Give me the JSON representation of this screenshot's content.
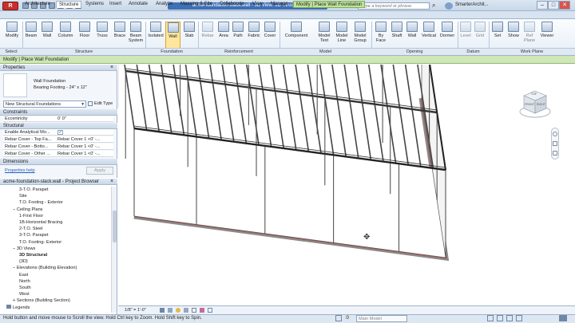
{
  "app": {
    "logo_letter": "R",
    "doc_title": "acme-foundation-slack.wall - 3D View: 3D Structural",
    "search_placeholder": "Type a keyword or phrase",
    "user": "SmarterArchit...",
    "min": "–",
    "max": "□",
    "close": "✕"
  },
  "tabs": [
    "Architecture",
    "Structure",
    "Systems",
    "Insert",
    "Annotate",
    "Analyze",
    "Massing & Site",
    "Collaborate",
    "View",
    "Manage",
    "Modify | Place Wall Foundation"
  ],
  "ribbon": {
    "buttons": [
      "Modify",
      "Beam",
      "Wall",
      "Column",
      "Floor",
      "Truss",
      "Brace",
      "Beam System",
      "Isolated",
      "Wall",
      "Slab",
      "Rebar",
      "Area",
      "Path",
      "Fabric",
      "Cover",
      "Component",
      "Model Text",
      "Model Line",
      "Model Group",
      "By Face",
      "Shaft",
      "Wall",
      "Vertical",
      "Dormer",
      "Level",
      "Grid",
      "Set",
      "Show",
      "Ref Plane",
      "Viewer"
    ],
    "panels": [
      "Select",
      "Structure",
      "Foundation",
      "Reinforcement",
      "Model",
      "Opening",
      "Datum",
      "Work Plane"
    ]
  },
  "options_bar": "Modify | Place Wall Foundation",
  "properties": {
    "title": "Properties",
    "type_name": "Wall Foundation",
    "type_sub": "Bearing Footing - 24\" x 12\"",
    "selector": "New Structural Foundations",
    "edit_type": "Edit Type",
    "sections": {
      "constraints": "Constraints",
      "structural": "Structural",
      "dimensions": "Dimensions"
    },
    "rows": [
      {
        "label": "Eccentricity",
        "value": "0' 0\""
      },
      {
        "label": "Enable Analytical Mo...",
        "value": "✓"
      },
      {
        "label": "Rebar Cover - Top Fa...",
        "value": "Rebar Cover 1 <0' -..."
      },
      {
        "label": "Rebar Cover - Botto...",
        "value": "Rebar Cover 1 <0' -..."
      },
      {
        "label": "Rebar Cover - Other ...",
        "value": "Rebar Cover 1 <0' -..."
      }
    ],
    "help": "Properties help",
    "apply": "Apply"
  },
  "browser": {
    "title": "acme-foundation-slack.wall - Project Browser",
    "items": [
      {
        "t": "3-T.O. Parapet",
        "l": 3
      },
      {
        "t": "Site",
        "l": 3
      },
      {
        "t": "T.O. Footing - Exterior",
        "l": 3
      },
      {
        "t": "Ceiling Plans",
        "l": 2,
        "exp": "−"
      },
      {
        "t": "1-First Floor",
        "l": 3
      },
      {
        "t": "1B-Horizontal Bracing",
        "l": 3
      },
      {
        "t": "2-T.O. Steel",
        "l": 3
      },
      {
        "t": "3-T.O. Parapet",
        "l": 3
      },
      {
        "t": "T.O. Footing- Exterior",
        "l": 3
      },
      {
        "t": "3D Views",
        "l": 2,
        "exp": "−"
      },
      {
        "t": "3D Structural",
        "l": 3,
        "b": true
      },
      {
        "t": "{3D}",
        "l": 3
      },
      {
        "t": "Elevations (Building Elevation)",
        "l": 2,
        "exp": "−"
      },
      {
        "t": "East",
        "l": 3
      },
      {
        "t": "North",
        "l": 3
      },
      {
        "t": "South",
        "l": 3
      },
      {
        "t": "West",
        "l": 3
      },
      {
        "t": "Sections (Building Section)",
        "l": 2,
        "exp": "+"
      },
      {
        "t": "Legends",
        "l": 1,
        "ico": true
      }
    ]
  },
  "viewcube": {
    "top": "TOP",
    "front": "FRONT",
    "right": "RIGHT"
  },
  "view_scale": "1/8\" = 1'-0\"",
  "status": {
    "hint": "Hold button and move mouse to Scroll the view. Hold Ctrl key to Zoom. Hold Shift key to Spin.",
    "zero": ":0",
    "model": "Main Model"
  }
}
